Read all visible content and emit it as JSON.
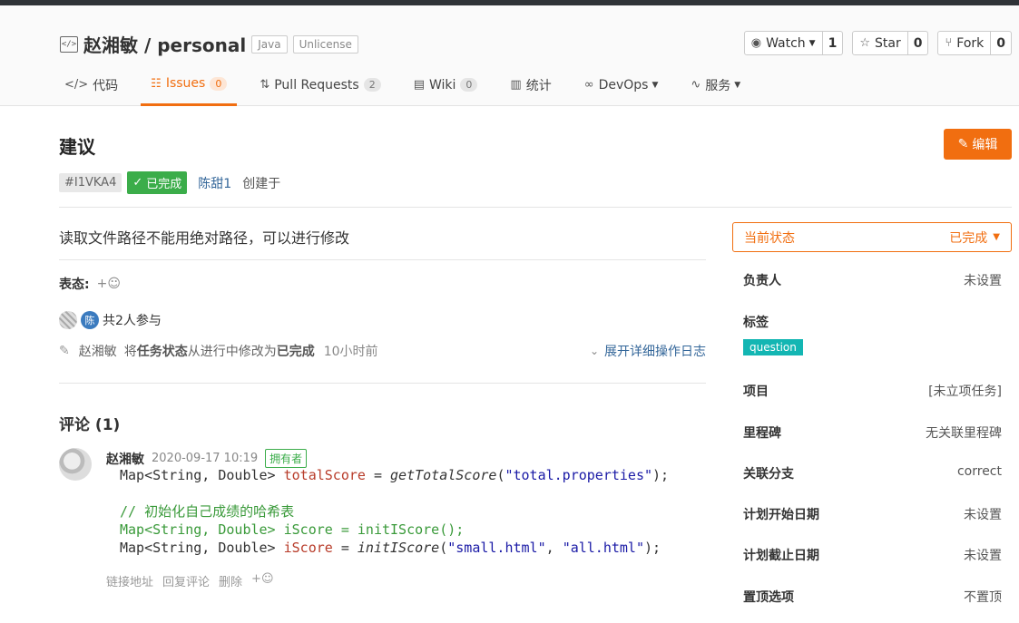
{
  "repo": {
    "owner_repo": "赵湘敏 / personal",
    "tags": [
      "Java",
      "Unlicense"
    ],
    "actions": [
      {
        "label": "Watch",
        "icon": "eye-icon",
        "count": "1",
        "dropdown": true
      },
      {
        "label": "Star",
        "icon": "star-icon",
        "count": "0",
        "dropdown": false
      },
      {
        "label": "Fork",
        "icon": "fork-icon",
        "count": "0",
        "dropdown": false
      }
    ]
  },
  "tabs": [
    {
      "label": "代码",
      "icon": "code-icon",
      "badge": ""
    },
    {
      "label": "Issues",
      "icon": "issues-icon",
      "badge": "0",
      "active": true
    },
    {
      "label": "Pull Requests",
      "icon": "pull-request-icon",
      "badge": "2"
    },
    {
      "label": "Wiki",
      "icon": "wiki-icon",
      "badge": "0"
    },
    {
      "label": "统计",
      "icon": "chart-icon",
      "badge": ""
    },
    {
      "label": "DevOps",
      "icon": "devops-icon",
      "badge": "",
      "dropdown": true
    },
    {
      "label": "服务",
      "icon": "pulse-icon",
      "badge": "",
      "dropdown": true
    }
  ],
  "issue": {
    "title": "建议",
    "edit_label": "编辑",
    "id": "#I1VKA4",
    "status": "已完成",
    "author": "陈甜1",
    "created_label": "创建于",
    "description": "读取文件路径不能用绝对路径，可以进行修改",
    "reaction_label": "表态:",
    "participants_text": "共2人参与",
    "participant_char": "陈",
    "activity": {
      "who": "赵湘敏",
      "text_a": "将",
      "field": "任务状态",
      "text_b": "从进行中修改为",
      "to": "已完成",
      "when": "10小时前",
      "expand_label": "展开详细操作日志"
    }
  },
  "comments": {
    "title": "评论 (1)",
    "items": [
      {
        "author": "赵湘敏",
        "time": "2020-09-17 10:19",
        "badge": "拥有者",
        "actions": [
          "链接地址",
          "回复评论",
          "删除"
        ]
      }
    ]
  },
  "code_lines": {
    "l1_type": "Map<String, Double> ",
    "l1_var": "totalScore",
    "l1_eq": " = ",
    "l1_fn": "getTotalScore",
    "l1_arg": "\"total.properties\"",
    "l1_end": ");",
    "l2_comment": "// 初始化自己成绩的哈希表",
    "l3_text": "Map<String, Double> iScore = initIScore();",
    "l4_type": "Map<String, Double> ",
    "l4_var": "iScore",
    "l4_eq": " = ",
    "l4_fn": "initIScore",
    "l4_arg1": "\"small.html\"",
    "l4_sep": ", ",
    "l4_arg2": "\"all.html\"",
    "l4_end": ");"
  },
  "sidebar": {
    "status_label": "当前状态",
    "status_value": "已完成",
    "rows": [
      {
        "label": "负责人",
        "value": "未设置"
      },
      {
        "label": "标签",
        "value": ""
      },
      {
        "label": "项目",
        "value": "[未立项任务]"
      },
      {
        "label": "里程碑",
        "value": "无关联里程碑"
      },
      {
        "label": "关联分支",
        "value": "correct"
      },
      {
        "label": "计划开始日期",
        "value": "未设置"
      },
      {
        "label": "计划截止日期",
        "value": "未设置"
      },
      {
        "label": "置顶选项",
        "value": "不置顶"
      }
    ],
    "label_tag": "question"
  },
  "colors": {
    "accent": "#f16e10",
    "success": "#3bad4a",
    "link": "#336699",
    "tag": "#13b6b3"
  }
}
